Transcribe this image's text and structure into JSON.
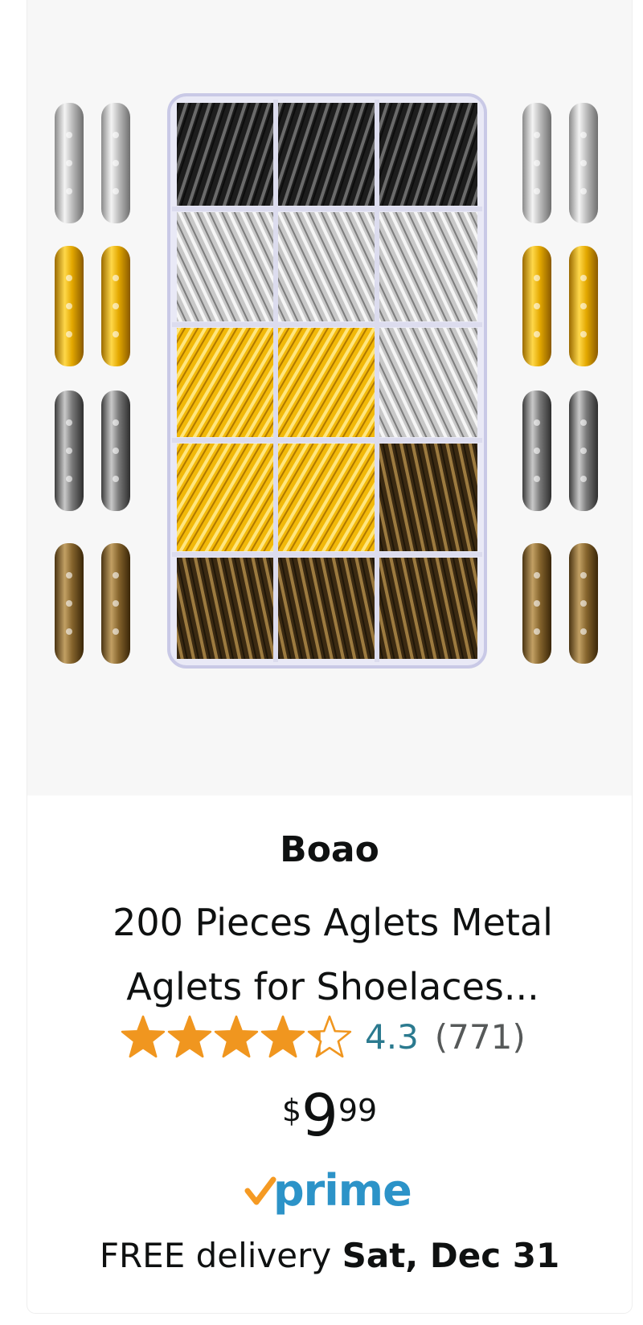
{
  "product": {
    "brand": "Boao",
    "title": "200 Pieces Aglets Metal Aglets for Shoelaces...",
    "rating": {
      "stars": 4.3,
      "value_text": "4.3",
      "count_text": "(771)"
    },
    "price": {
      "symbol": "$",
      "whole": "9",
      "fraction": "99"
    },
    "prime_label": "prime",
    "delivery": {
      "prefix": "FREE delivery",
      "date": "Sat, Dec 31"
    }
  },
  "colors": {
    "star": "#f0961f",
    "rating_link": "#2b7a8f",
    "prime_blue": "#2c93c8",
    "prime_check": "#f59a23",
    "image_bg": "#f7f7f7"
  },
  "icons": {
    "rating": "star-icon",
    "prime": "prime-check-icon"
  }
}
